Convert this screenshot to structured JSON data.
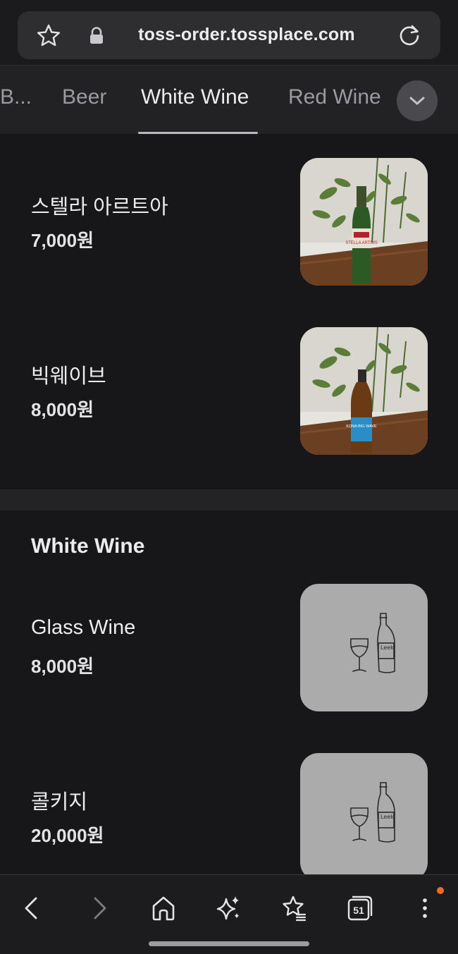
{
  "browser": {
    "url": "toss-order.tossplace.com",
    "star_icon": "star-outline-icon",
    "lock_icon": "lock-icon",
    "reload_icon": "reload-icon"
  },
  "tabs": [
    {
      "label": "B..."
    },
    {
      "label": "Beer"
    },
    {
      "label": "White Wine",
      "active": true
    },
    {
      "label": "Red Wine"
    }
  ],
  "tab_expand_icon": "chevron-down-icon",
  "beer_items": [
    {
      "name": "스텔라 아르트아",
      "price": "7,000원",
      "label_text": "STELLA ARTOIS"
    },
    {
      "name": "빅웨이브",
      "price": "8,000원",
      "label_text": "KONA BIG WAVE"
    }
  ],
  "white_wine_section": {
    "title": "White Wine",
    "items": [
      {
        "name": "Glass Wine",
        "price": "8,000원",
        "illustration_text": "Leek"
      },
      {
        "name": "콜키지",
        "price": "20,000원",
        "illustration_text": "Leek"
      }
    ]
  },
  "bottom_nav": {
    "tabs_count": "51",
    "icons": [
      "back-icon",
      "forward-icon",
      "home-icon",
      "sparkle-icon",
      "bookmarks-icon",
      "tabs-icon",
      "more-icon"
    ]
  },
  "colors": {
    "background": "#17171a",
    "tabbar": "#222225",
    "thumb_placeholder": "#ababab",
    "notification_dot": "#f06a2a"
  }
}
